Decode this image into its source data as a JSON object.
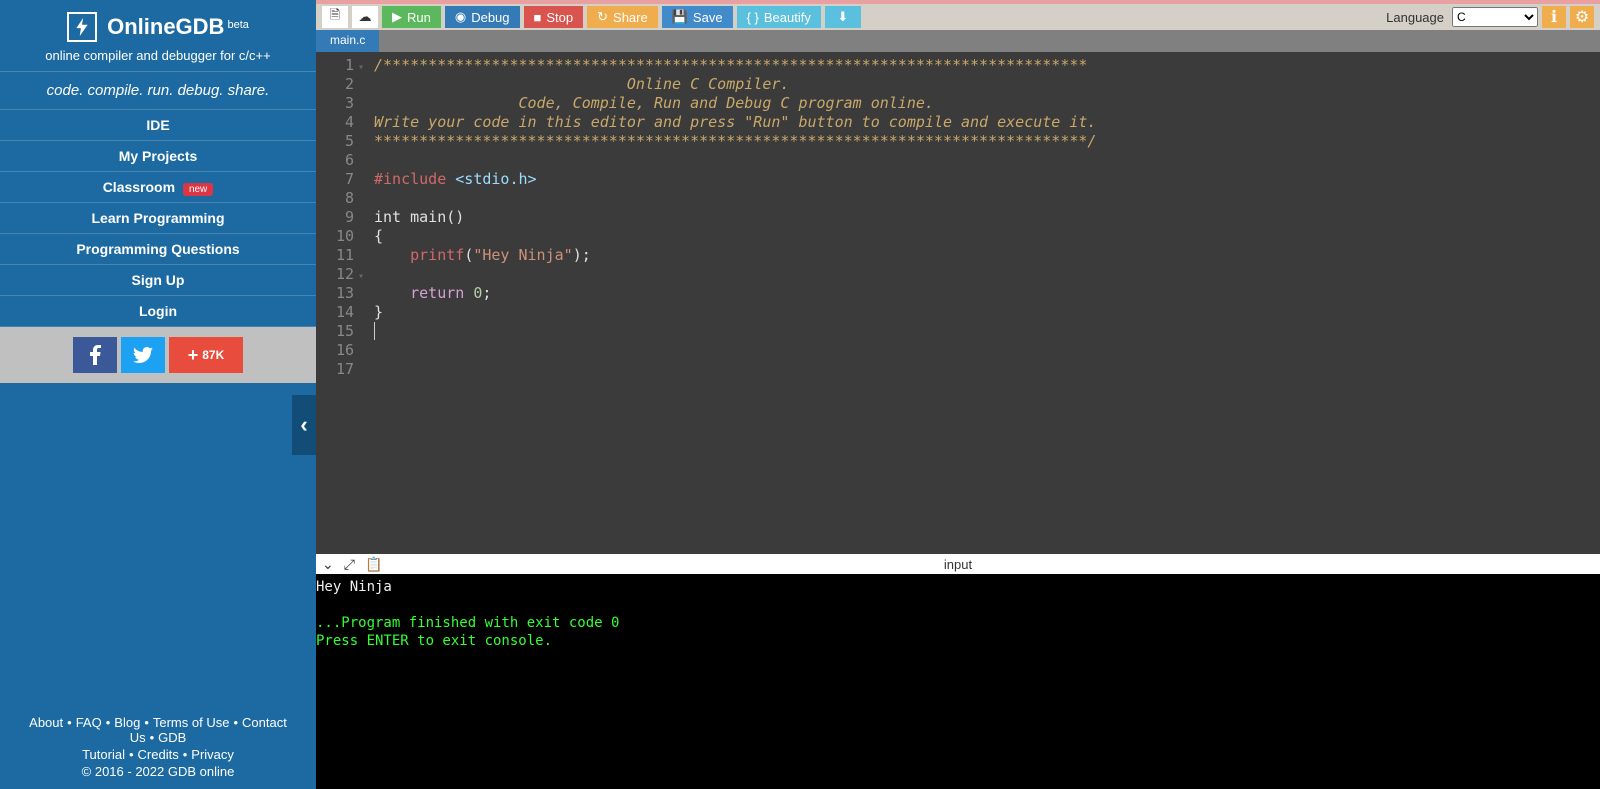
{
  "brand": {
    "name": "OnlineGDB",
    "beta": "beta",
    "subtitle": "online compiler and debugger for c/c++",
    "tagline": "code. compile. run. debug. share."
  },
  "nav": {
    "items": [
      "IDE",
      "My Projects",
      "Classroom",
      "Learn Programming",
      "Programming Questions",
      "Sign Up",
      "Login"
    ],
    "classroom_badge": "new"
  },
  "social": {
    "share_count": "87K"
  },
  "footer": {
    "row1": [
      "About",
      "FAQ",
      "Blog",
      "Terms of Use",
      "Contact Us",
      "GDB"
    ],
    "row2": [
      "Tutorial",
      "Credits",
      "Privacy"
    ],
    "copyright": "© 2016 - 2022 GDB online"
  },
  "toolbar": {
    "run": "Run",
    "debug": "Debug",
    "stop": "Stop",
    "share": "Share",
    "save": "Save",
    "beautify": "Beautify",
    "language_label": "Language",
    "language_value": "C"
  },
  "tab": {
    "name": "main.c"
  },
  "code": {
    "lines": [
      "/******************************************************************************",
      "",
      "                            Online C Compiler.",
      "                Code, Compile, Run and Debug C program online.",
      "Write your code in this editor and press \"Run\" button to compile and execute it.",
      "",
      "*******************************************************************************/",
      "",
      "#include <stdio.h>",
      "",
      "int main()",
      "{",
      "    printf(\"Hey Ninja\");",
      "",
      "    return 0;",
      "}",
      ""
    ]
  },
  "console_bar": {
    "label": "input"
  },
  "console": {
    "line1": "Hey Ninja",
    "line2": "",
    "line3": "...Program finished with exit code 0",
    "line4": "Press ENTER to exit console."
  }
}
